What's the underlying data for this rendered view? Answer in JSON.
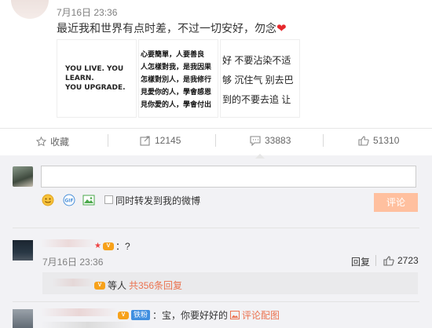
{
  "post": {
    "time": "7月16日 23:36",
    "text": "最近我和世界有点时差，不过一切安好，勿念",
    "images": [
      {
        "text": "YOU LIVE. YOU LEARN.\nYOU UPGRADE."
      },
      {
        "lines": [
          "心要簡單，人要善良",
          "人怎樣對我，是我因果",
          "怎樣對別人，是我修行",
          "見愛你的人，學會感恩",
          "見你愛的人，學會付出"
        ]
      },
      {
        "lines": [
          "好 不要沾染不适",
          "够 沉住气 别去巴",
          "到的不要去追 让"
        ]
      }
    ]
  },
  "actions": {
    "collect": "收藏",
    "forward": "12145",
    "comment": "33883",
    "like": "51310"
  },
  "composer": {
    "placeholder": "",
    "checkbox_label": "同时转发到我的微博",
    "submit": "评论"
  },
  "comments": [
    {
      "text": "：?",
      "time": "7月16日 23:36",
      "reply_label": "回复",
      "likes": "2723",
      "sub_reply": {
        "prefix": "等人",
        "link": "共356条回复"
      }
    },
    {
      "fans_badge": "铁粉",
      "text": "：宝，你要好好的",
      "peitu": "评论配图"
    }
  ],
  "colors": {
    "accent": "#eb7350",
    "submit_bg": "#ffc09f",
    "heart": "#e6282c"
  }
}
